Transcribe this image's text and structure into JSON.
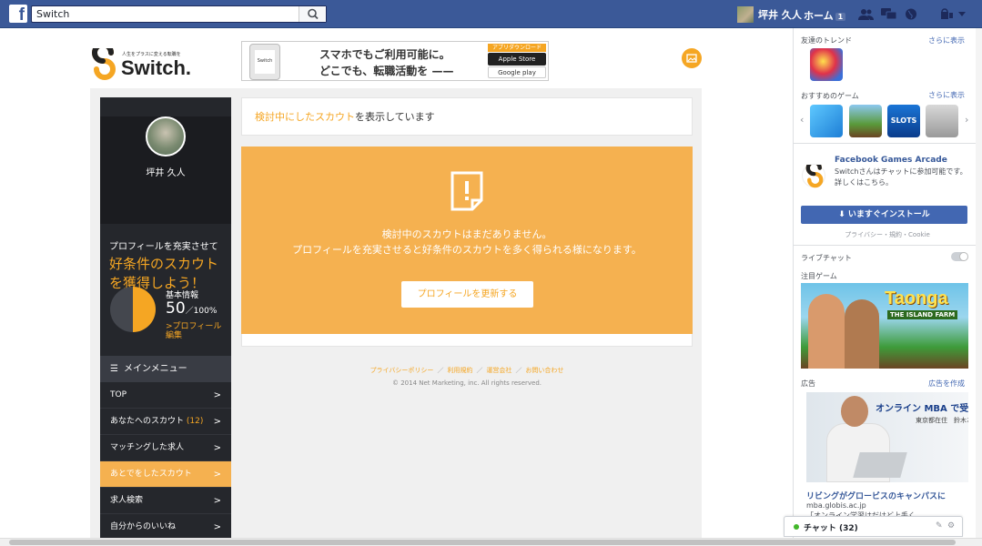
{
  "fb": {
    "search_value": "Switch",
    "user_name": "坪井 久人",
    "home_label": "ホーム",
    "home_badge": "1"
  },
  "site": {
    "logo_tagline": "人生をプラスに変える転職を",
    "logo_name": "Switch."
  },
  "banner": {
    "phone_label": "Switch",
    "line1": "スマホでもご利用可能に。",
    "line2": "どこでも、転職活動を ——",
    "app_header": "アプリダウンロード",
    "app_store": "Apple Store",
    "google_play": "Google play"
  },
  "sidebar": {
    "user_name": "坪井 久人",
    "promo_line1": "プロフィールを充実させて",
    "promo_line2": "好条件のスカウト",
    "promo_line3": "を獲得しよう！",
    "basic_label": "基本情報",
    "progress_value": "50",
    "progress_unit": "／100%",
    "progress_fraction": 0.5,
    "edit_link": ">プロフィール編集",
    "menu_header": "メインメニュー",
    "menu": [
      {
        "label": "TOP",
        "count": ""
      },
      {
        "label": "あなたへのスカウト",
        "count": "(12)"
      },
      {
        "label": "マッチングした求人",
        "count": ""
      },
      {
        "label": "あとでをしたスカウト",
        "count": ""
      },
      {
        "label": "求人検索",
        "count": ""
      },
      {
        "label": "自分からのいいね",
        "count": ""
      }
    ],
    "arrow": ">"
  },
  "content": {
    "notice_highlight": "検討中にしたスカウト",
    "notice_rest": "を表示しています",
    "empty_line1": "検討中のスカウトはまだありません。",
    "empty_line2": "プロフィールを充実させると好条件のスカウトを多く得られる様になります。",
    "update_button": "プロフィールを更新する"
  },
  "footer": {
    "links": [
      "プライバシーポリシー",
      "利用規約",
      "運営会社",
      "お問い合わせ"
    ],
    "separator": "／",
    "copyright": "© 2014 Net Marketing, inc. All rights reserved."
  },
  "right": {
    "trend_header": "友達のトレンド",
    "see_more": "さらに表示",
    "games_header": "おすすめのゲーム",
    "slots_label": "SLOTS",
    "arcade_title": "Facebook Games Arcade",
    "arcade_desc": "Switchさんはチャットに参加可能です。",
    "arcade_more": "詳しくはこちら。",
    "install_button": "いますぐインストール",
    "privacy": "プライバシー・規約・Cookie",
    "live_chat": "ライブチャット",
    "featured_header": "注目ゲーム",
    "featured_logo": "Taonga",
    "featured_sub": "THE ISLAND FARM",
    "ads_header": "広告",
    "create_ad": "広告を作成",
    "ad_banner_line1": "オンライン MBA で受講中",
    "ad_banner_line2": "東京都在住　鈴木さん",
    "ad_title": "リビングがグロービスのキャンパスに",
    "ad_url": "mba.globis.ac.jp",
    "ad_text": "「オンライン学習はだけど上手く...",
    "chat_label": "チャット (32)"
  },
  "colors": {
    "fb_blue": "#3b5998",
    "accent_orange": "#f5a623",
    "sidebar_dark": "#25272c",
    "active_item": "#f5b150"
  }
}
